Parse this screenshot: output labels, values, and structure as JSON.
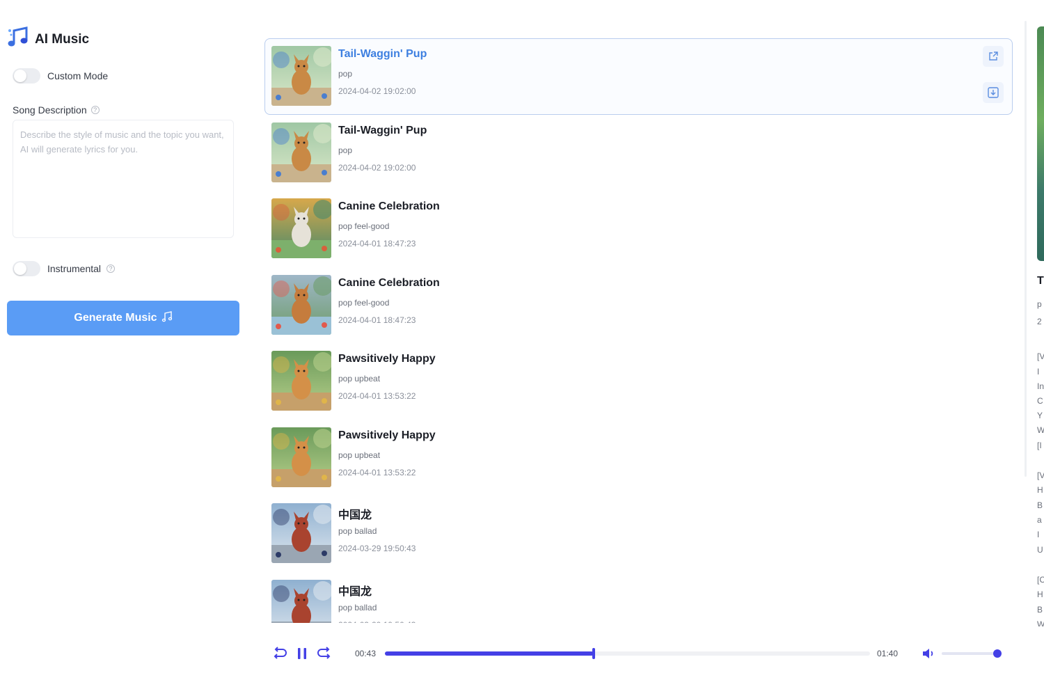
{
  "app": {
    "title": "AI Music"
  },
  "sidebar": {
    "custom_mode_label": "Custom Mode",
    "song_description_label": "Song Description",
    "song_description_placeholder": "Describe the style of music and the topic you want, AI will generate lyrics for you.",
    "song_description_value": "",
    "instrumental_label": "Instrumental",
    "generate_label": "Generate Music"
  },
  "songs": [
    {
      "title": "Tail-Waggin' Pup",
      "tags": "pop",
      "date": "2024-04-02 19:02:00",
      "active": true,
      "thumb": "dog-park"
    },
    {
      "title": "Tail-Waggin' Pup",
      "tags": "pop",
      "date": "2024-04-02 19:02:00",
      "active": false,
      "thumb": "dog-park"
    },
    {
      "title": "Canine Celebration",
      "tags": "pop feel-good",
      "date": "2024-04-01 18:47:23",
      "active": false,
      "thumb": "dog-flowers"
    },
    {
      "title": "Canine Celebration",
      "tags": "pop feel-good",
      "date": "2024-04-01 18:47:23",
      "active": false,
      "thumb": "dog-stream"
    },
    {
      "title": "Pawsitively Happy",
      "tags": "pop upbeat",
      "date": "2024-04-01 13:53:22",
      "active": false,
      "thumb": "dog-forest"
    },
    {
      "title": "Pawsitively Happy",
      "tags": "pop upbeat",
      "date": "2024-04-01 13:53:22",
      "active": false,
      "thumb": "dog-forest"
    },
    {
      "title": "中国龙",
      "tags": "pop ballad",
      "date": "2024-03-29 19:50:43",
      "active": false,
      "thumb": "dragon"
    },
    {
      "title": "中国龙",
      "tags": "pop ballad",
      "date": "2024-03-29 19:50:43",
      "active": false,
      "thumb": "dragon"
    }
  ],
  "right_panel": {
    "title_initial": "T",
    "letters": [
      "p",
      "2",
      "[V",
      "I",
      "In",
      "C",
      "Y",
      "W",
      "[I",
      "[V",
      "H",
      "B",
      "a",
      "I",
      "U",
      "[C",
      "H",
      "B",
      "W"
    ]
  },
  "player": {
    "current_time": "00:43",
    "duration": "01:40",
    "progress": 0.43,
    "volume": 1.0
  },
  "colors": {
    "accent": "#4440e6",
    "generate_button": "#5a9cf5",
    "active_title": "#3d7fe0"
  },
  "icons": {
    "brand": "music-note-icon",
    "song_open": "external-link-icon",
    "song_download": "download-icon",
    "rewind": "rewind-icon",
    "pause": "pause-icon",
    "forward": "forward-icon",
    "volume": "volume-icon"
  }
}
